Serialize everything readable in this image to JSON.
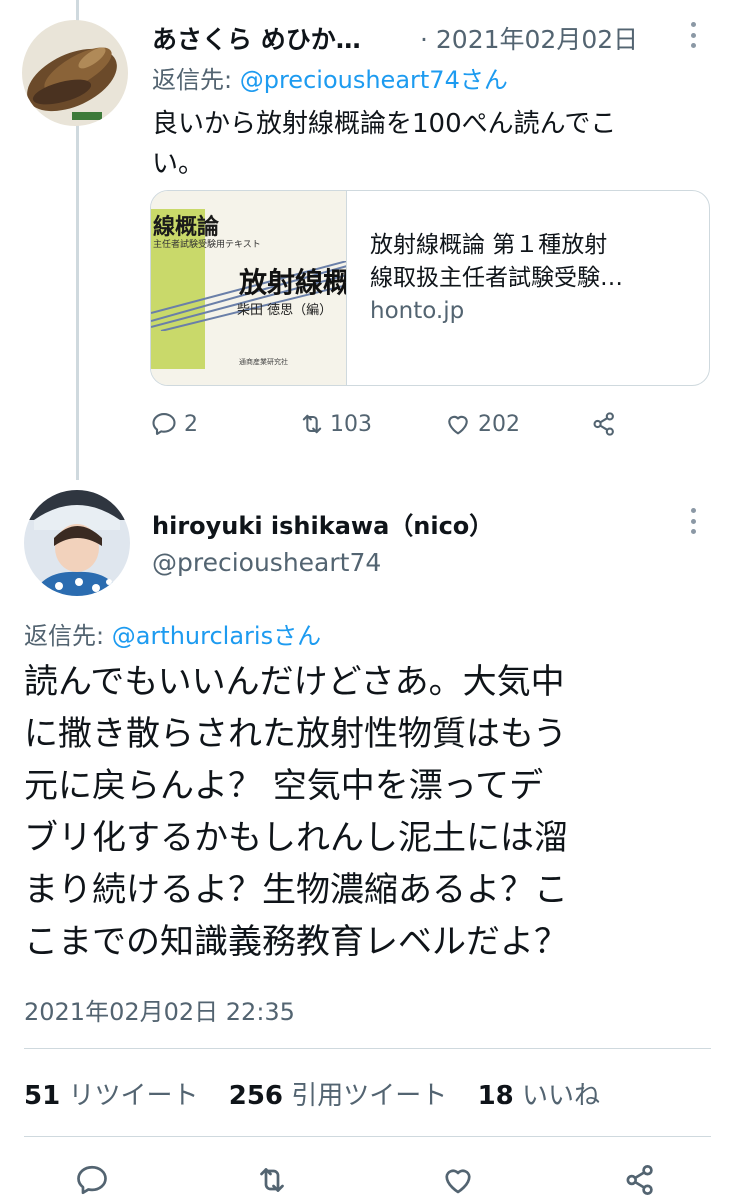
{
  "tweet1": {
    "author_name": "あさくら めひか…",
    "date": "· 2021年02月02日",
    "reply_prefix": "返信先:",
    "reply_handle": "@preciousheart74さん",
    "text_line1": "良いから放射線概論を100ぺん読んでこ",
    "text_line2": "い。",
    "card": {
      "thumb_title": "線概論",
      "thumb_subtitle": "主任者試験受験用テキスト",
      "thumb_big": "放射線概",
      "thumb_author": "柴田 徳思（編）",
      "thumb_publisher": "通商産業研究社",
      "title_line1": "放射線概論 第１種放射",
      "title_line2": "線取扱主任者試験受験…",
      "domain": "honto.jp"
    },
    "actions": {
      "replies": "2",
      "retweets": "103",
      "likes": "202"
    }
  },
  "tweet2": {
    "author_name": "hiroyuki ishikawa（nico）",
    "author_handle": "@preciousheart74",
    "reply_prefix": "返信先:",
    "reply_handle": "@arthurclarisさん",
    "lines": [
      "読んでもいいんだけどさあ。大気中",
      "に撒き散らされた放射性物質はもう",
      "元に戻らんよ？ 空気中を漂ってデ",
      "ブリ化するかもしれんし泥土には溜",
      "まり続けるよ？生物濃縮あるよ？こ",
      "こまでの知識義務教育レベルだよ？"
    ],
    "timestamp": "2021年02月02日 22:35",
    "stats": {
      "retweets_count": "51",
      "retweets_label": "リツイート",
      "quotes_count": "256",
      "quotes_label": "引用ツイート",
      "likes_count": "18",
      "likes_label": "いいね"
    }
  },
  "colors": {
    "link": "#1d9bf0",
    "secondary": "#536471",
    "border": "#cfd9de"
  },
  "icons": [
    "reply-icon",
    "retweet-icon",
    "like-icon",
    "share-icon",
    "more-icon"
  ]
}
